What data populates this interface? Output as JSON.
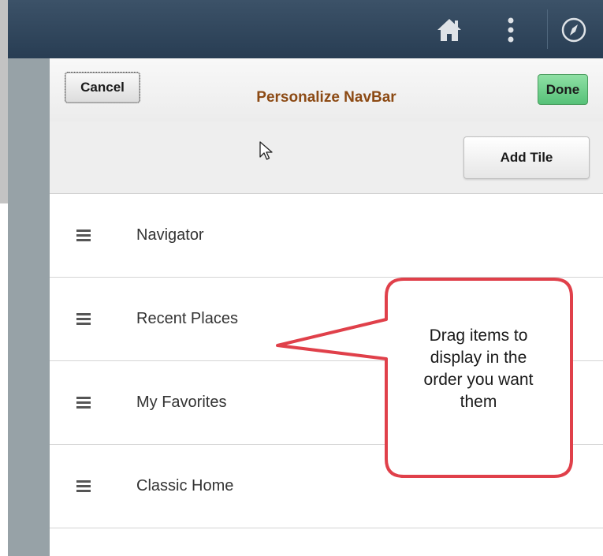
{
  "header": {
    "icons": [
      "home-icon",
      "more-icon",
      "compass-icon"
    ]
  },
  "panel": {
    "title": "Personalize NavBar",
    "cancel_label": "Cancel",
    "done_label": "Done",
    "add_tile_label": "Add Tile"
  },
  "nav_items": [
    {
      "label": "Navigator",
      "icon": "drag-handle-icon"
    },
    {
      "label": "Recent Places",
      "icon": "drag-handle-icon"
    },
    {
      "label": "My Favorites",
      "icon": "drag-handle-icon"
    },
    {
      "label": "Classic Home",
      "icon": "drag-handle-icon"
    }
  ],
  "callout": {
    "lines": [
      "Drag items to",
      "display in the",
      "order you want",
      "them"
    ]
  },
  "colors": {
    "header_bg": "#33495e",
    "title": "#8c4a14",
    "done_bg": "#6fd08c",
    "callout_border": "#e0404a"
  }
}
